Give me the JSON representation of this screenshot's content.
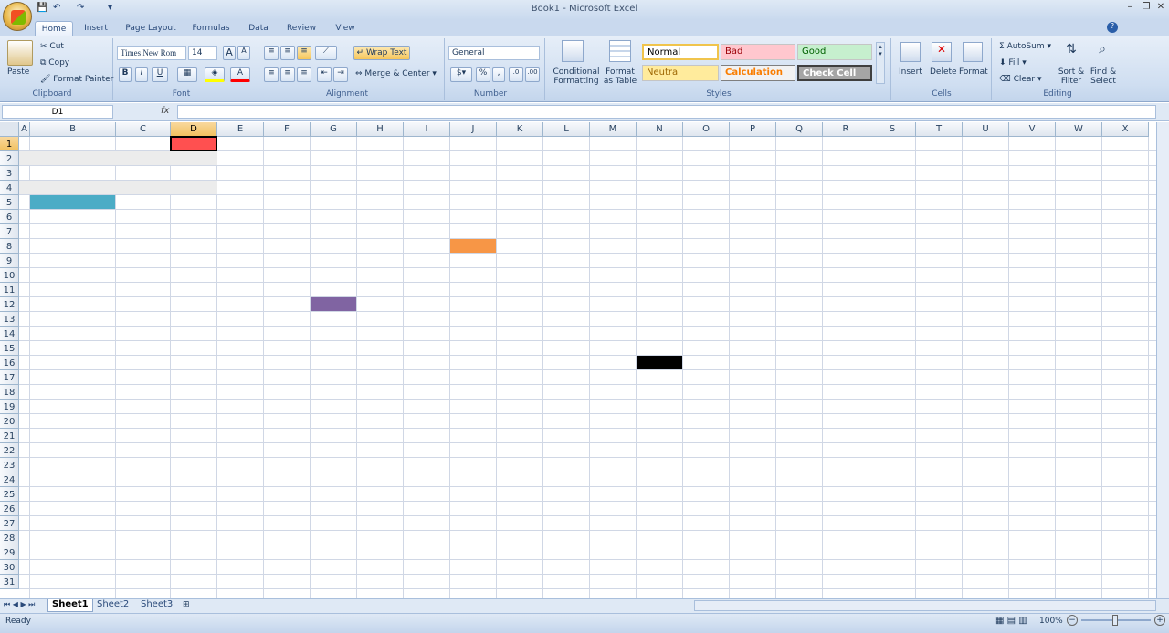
{
  "window": {
    "title": "Book1 - Microsoft Excel"
  },
  "qat": {
    "save": "💾",
    "undo": "↶",
    "redo": "↷",
    "more": "▾"
  },
  "window_controls": {
    "minimize": "–",
    "restore": "❐",
    "close": "✕"
  },
  "tabs": [
    "Home",
    "Insert",
    "Page Layout",
    "Formulas",
    "Data",
    "Review",
    "View"
  ],
  "active_tab": "Home",
  "clipboard": {
    "paste": "Paste",
    "cut": "Cut",
    "copy": "Copy",
    "format_painter": "Format Painter",
    "label": "Clipboard"
  },
  "font": {
    "name": "Times New Rom",
    "size": "14",
    "grow": "A",
    "shrink": "A",
    "bold": "B",
    "italic": "I",
    "underline": "U",
    "label": "Font"
  },
  "alignment": {
    "wrap_text": "Wrap Text",
    "merge_center": "Merge & Center",
    "label": "Alignment"
  },
  "number": {
    "format": "General",
    "percent": "%",
    "comma": ",",
    "label": "Number"
  },
  "styles": {
    "conditional_formatting": "Conditional Formatting",
    "format_as_table": "Format as Table",
    "normal": "Normal",
    "bad": "Bad",
    "good": "Good",
    "neutral": "Neutral",
    "calculation": "Calculation",
    "check_cell": "Check Cell",
    "label": "Styles"
  },
  "cells": {
    "insert": "Insert",
    "delete": "Delete",
    "format": "Format",
    "label": "Cells"
  },
  "editing": {
    "autosum": "AutoSum",
    "fill": "Fill",
    "clear": "Clear",
    "sort_filter": "Sort & Filter",
    "find_select": "Find & Select",
    "label": "Editing"
  },
  "formula_bar": {
    "name_box": "D1",
    "fx": "fx",
    "value": ""
  },
  "columns": [
    "A",
    "B",
    "C",
    "D",
    "E",
    "F",
    "G",
    "H",
    "I",
    "J",
    "K",
    "L",
    "M",
    "N",
    "O",
    "P",
    "Q",
    "R",
    "S",
    "T",
    "U",
    "V",
    "W",
    "X"
  ],
  "rows": [
    "1",
    "2",
    "3",
    "4",
    "5",
    "6",
    "7",
    "8",
    "9",
    "10",
    "11",
    "12",
    "13",
    "14",
    "15",
    "16",
    "17",
    "18",
    "19",
    "20",
    "21",
    "22",
    "23",
    "24",
    "25",
    "26",
    "27",
    "28",
    "29",
    "30",
    "31"
  ],
  "selected_cell": {
    "column": "D",
    "row": "1"
  },
  "filled_cells": [
    {
      "cell": "D1",
      "color": "#ff5050"
    },
    {
      "cell": "B5",
      "color": "#4bacc6"
    },
    {
      "cell": "J8",
      "color": "#f79646"
    },
    {
      "cell": "G12",
      "color": "#8064a2"
    },
    {
      "cell": "N16",
      "color": "#000000"
    }
  ],
  "banded_rows": [
    {
      "row": "2",
      "color": "#ececec"
    },
    {
      "row": "4",
      "color": "#ececec"
    }
  ],
  "sheets": [
    "Sheet1",
    "Sheet2",
    "Sheet3"
  ],
  "active_sheet": "Sheet1",
  "status": {
    "text": "Ready",
    "zoom": "100%"
  }
}
